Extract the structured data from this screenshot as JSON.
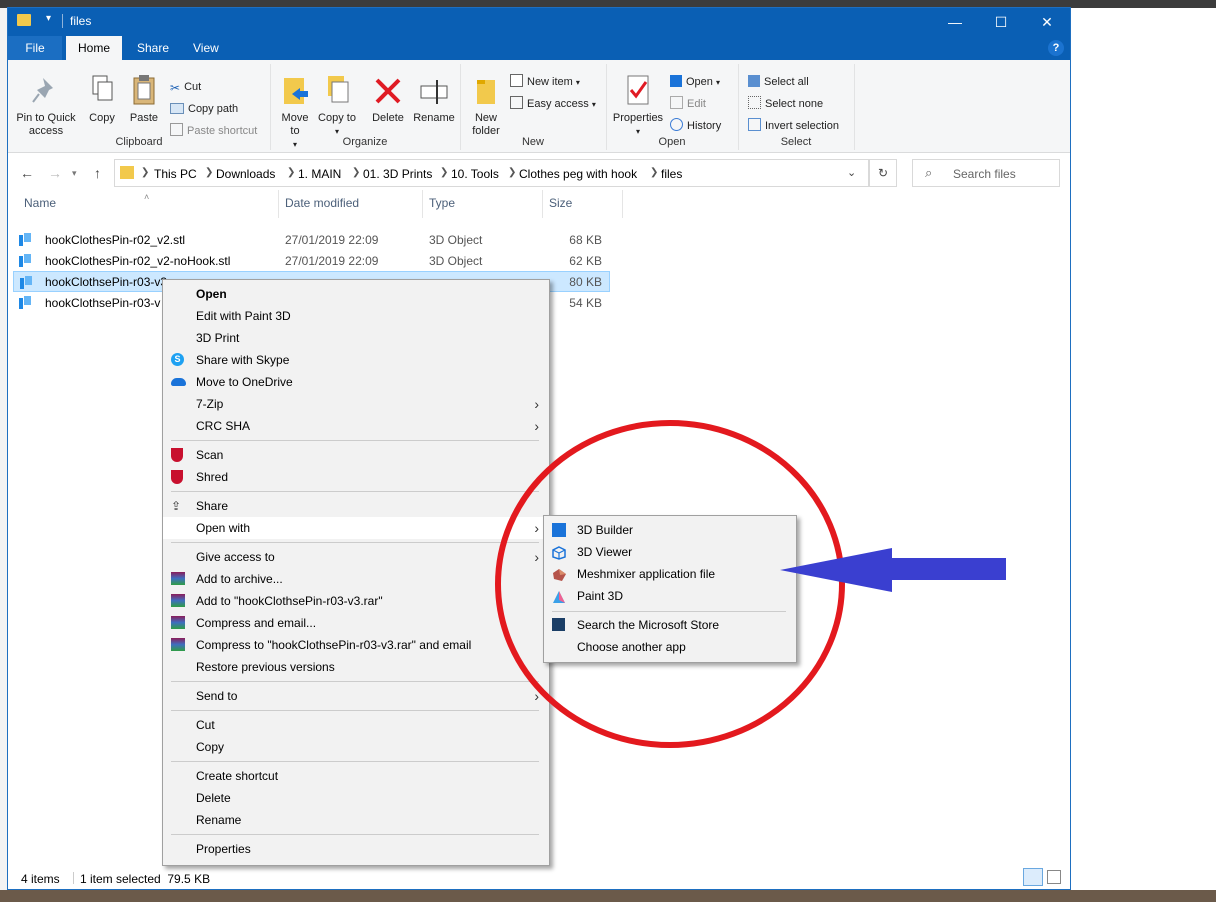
{
  "window": {
    "title": "files"
  },
  "title_buttons": {
    "minimize": "—",
    "maximize": "☐",
    "close": "✕"
  },
  "ribbon_tabs": [
    "File",
    "Home",
    "Share",
    "View"
  ],
  "help": "?",
  "ribbon": {
    "clipboard": {
      "label": "Clipboard",
      "pin": "Pin to Quick access",
      "copy": "Copy",
      "paste": "Paste",
      "cut": "Cut",
      "copy_path": "Copy path",
      "paste_shortcut": "Paste shortcut"
    },
    "organize": {
      "label": "Organize",
      "move_to": "Move to",
      "copy_to": "Copy to",
      "delete": "Delete",
      "rename": "Rename"
    },
    "new": {
      "label": "New",
      "new_folder": "New folder",
      "new_item": "New item",
      "easy_access": "Easy access"
    },
    "open": {
      "label": "Open",
      "properties": "Properties",
      "open": "Open",
      "edit": "Edit",
      "history": "History"
    },
    "select": {
      "label": "Select",
      "select_all": "Select all",
      "select_none": "Select none",
      "invert": "Invert selection"
    }
  },
  "address": {
    "crumbs": [
      "This PC",
      "Downloads",
      "1. MAIN",
      "01. 3D Prints",
      "10. Tools",
      "Clothes peg with hook",
      "files"
    ],
    "search_placeholder": "Search files"
  },
  "columns": {
    "name": "Name",
    "date": "Date modified",
    "type": "Type",
    "size": "Size"
  },
  "files": [
    {
      "name": "hookClothesPin-r02_v2.stl",
      "date": "27/01/2019 22:09",
      "type": "3D Object",
      "size": "68 KB"
    },
    {
      "name": "hookClothesPin-r02_v2-noHook.stl",
      "date": "27/01/2019 22:09",
      "type": "3D Object",
      "size": "62 KB"
    },
    {
      "name": "hookClothsePin-r03-v3",
      "size": "80 KB"
    },
    {
      "name": "hookClothsePin-r03-v",
      "size": "54 KB"
    }
  ],
  "status": {
    "items": "4 items",
    "selected": "1 item selected  79.5 KB"
  },
  "context_menu": {
    "open": "Open",
    "edit_paint3d": "Edit with Paint 3D",
    "print3d": "3D Print",
    "skype": "Share with Skype",
    "onedrive": "Move to OneDrive",
    "zip": "7-Zip",
    "crc": "CRC SHA",
    "scan": "Scan",
    "shred": "Shred",
    "share": "Share",
    "open_with": "Open with",
    "give_access": "Give access to",
    "add_archive": "Add to archive...",
    "add_rar": "Add to \"hookClothsePin-r03-v3.rar\"",
    "compress_email": "Compress and email...",
    "compress_rar_email": "Compress to \"hookClothsePin-r03-v3.rar\" and email",
    "restore": "Restore previous versions",
    "send_to": "Send to",
    "cut": "Cut",
    "copy": "Copy",
    "create_shortcut": "Create shortcut",
    "delete": "Delete",
    "rename": "Rename",
    "properties": "Properties"
  },
  "open_with_menu": {
    "builder": "3D Builder",
    "viewer": "3D Viewer",
    "meshmixer": "Meshmixer application file",
    "paint3d": "Paint 3D",
    "store": "Search the Microsoft Store",
    "choose": "Choose another app"
  },
  "annotation_colors": {
    "circle": "#e3191e",
    "arrow": "#3a3fd0"
  }
}
